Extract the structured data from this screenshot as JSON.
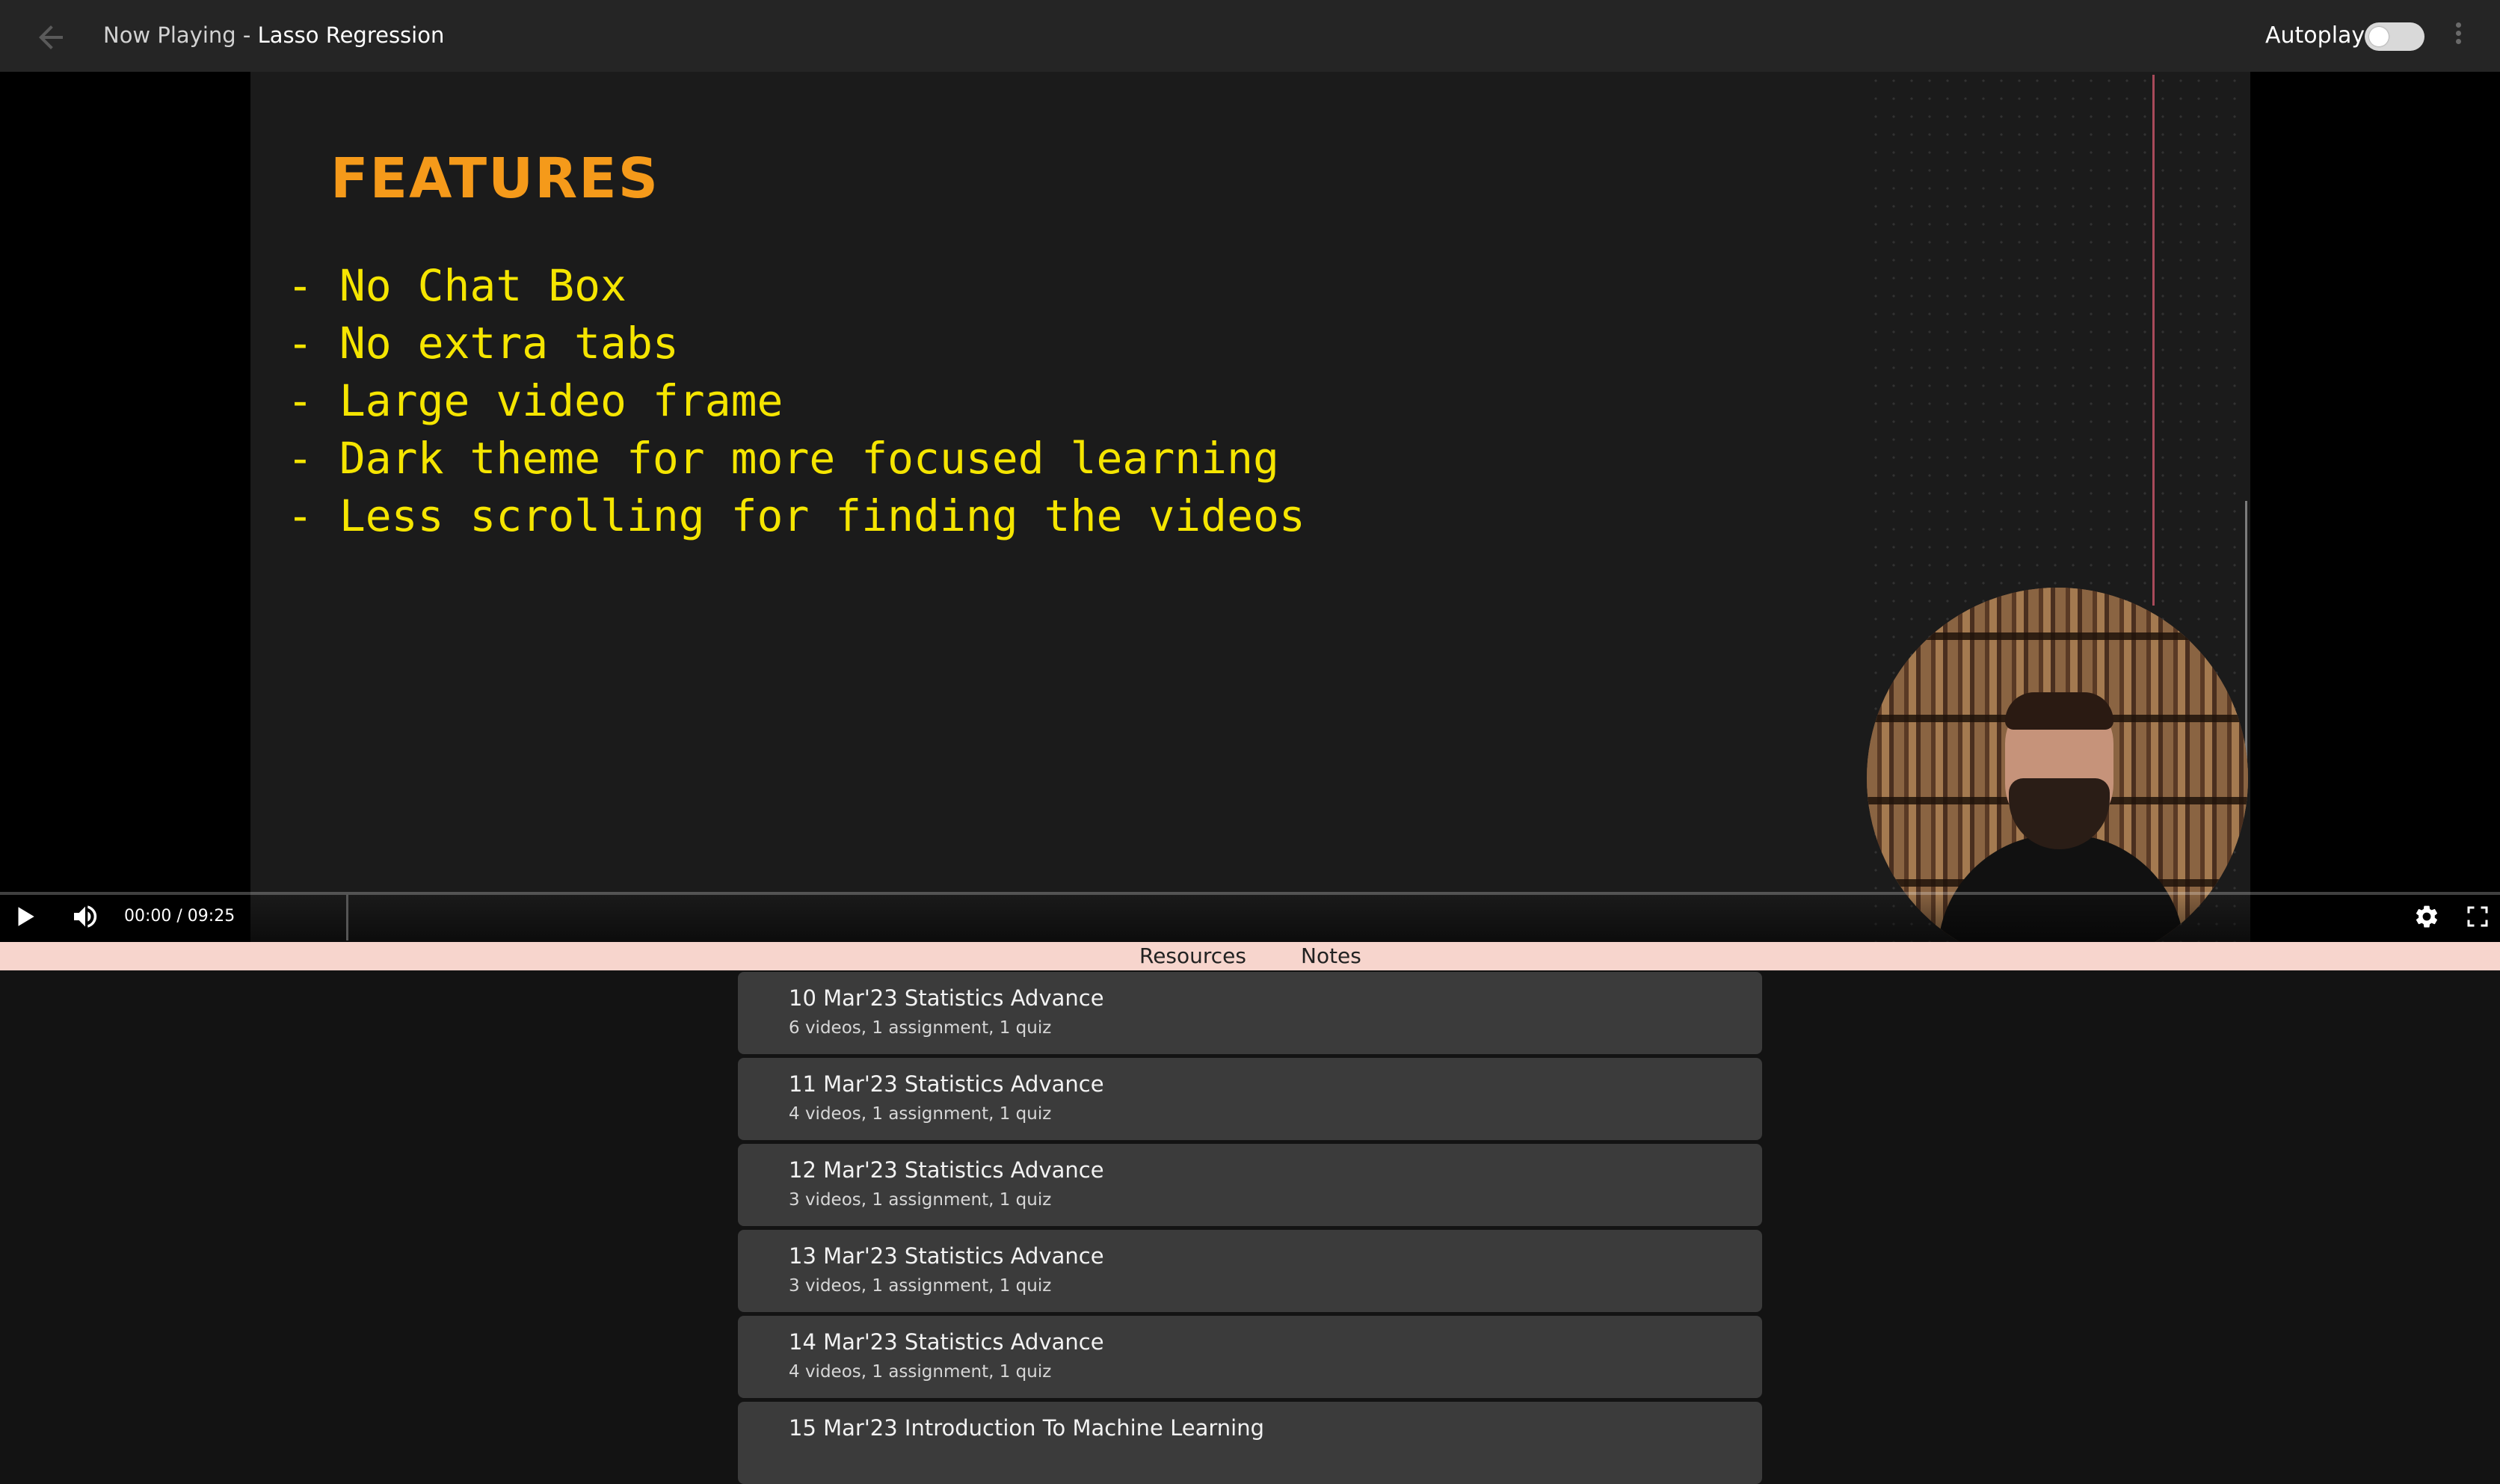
{
  "header": {
    "now_playing_prefix": "Now Playing",
    "separator": " - ",
    "lesson_title": "Lasso Regression",
    "autoplay_label": "Autoplay",
    "autoplay_on": false,
    "icons": {
      "back": "arrow-left-icon",
      "more": "kebab-menu-icon"
    }
  },
  "slide": {
    "heading": "FEATURES",
    "bullets": [
      "- No Chat Box",
      "- No extra tabs",
      "- Large video frame",
      "- Dark theme for more focused learning",
      "- Less scrolling for finding the videos"
    ],
    "colors": {
      "heading": "#f59a1a",
      "bullets": "#f5e500",
      "background": "#1b1b1b"
    }
  },
  "player": {
    "current_time": "00:00",
    "duration": "09:25",
    "time_display": "00:00 / 09:25",
    "progress_fraction": 0.0,
    "icons": {
      "play": "play-icon",
      "volume": "volume-icon",
      "settings": "gear-icon",
      "fullscreen": "fullscreen-icon"
    }
  },
  "tabs": [
    {
      "label": "Resources"
    },
    {
      "label": "Notes"
    }
  ],
  "courses": [
    {
      "title": "10 Mar'23 Statistics Advance",
      "meta": "6 videos, 1 assignment, 1 quiz"
    },
    {
      "title": "11 Mar'23 Statistics Advance",
      "meta": "4 videos, 1 assignment, 1 quiz"
    },
    {
      "title": "12 Mar'23 Statistics Advance",
      "meta": "3 videos, 1 assignment, 1 quiz"
    },
    {
      "title": "13 Mar'23 Statistics Advance",
      "meta": "3 videos, 1 assignment, 1 quiz"
    },
    {
      "title": "14 Mar'23 Statistics Advance",
      "meta": "4 videos, 1 assignment, 1 quiz"
    },
    {
      "title": "15 Mar'23 Introduction To Machine Learning",
      "meta": ""
    }
  ]
}
